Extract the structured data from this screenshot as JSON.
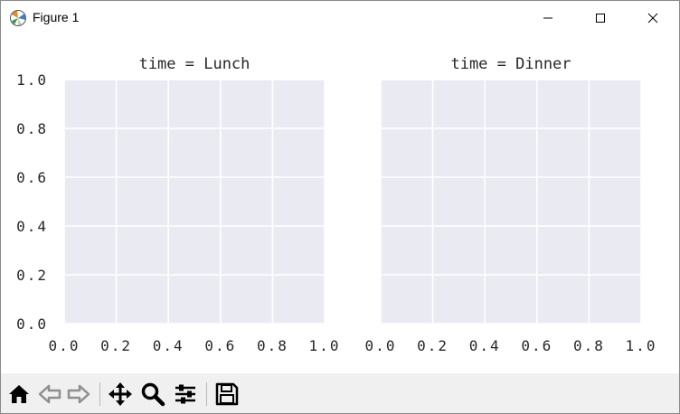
{
  "window": {
    "title": "Figure 1",
    "icons": [
      "matplotlib-icon",
      "minimize-icon",
      "maximize-icon",
      "close-icon"
    ]
  },
  "toolbar": {
    "buttons": [
      "home-icon",
      "back-icon",
      "forward-icon",
      "pan-icon",
      "zoom-icon",
      "configure-subplots-icon",
      "save-icon"
    ]
  },
  "colors": {
    "axes_face": "#eaeaf2",
    "grid": "#ffffff",
    "toolbar_bg": "#f0f0f0",
    "icon": "#000000",
    "icon_disabled": "#8f8f8f"
  },
  "chart_data": [
    {
      "type": "scatter",
      "title": "time = Lunch",
      "xlim": [
        0.0,
        1.0
      ],
      "ylim": [
        0.0,
        1.0
      ],
      "xticks": [
        "0.0",
        "0.2",
        "0.4",
        "0.6",
        "0.8",
        "1.0"
      ],
      "yticks": [
        "0.0",
        "0.2",
        "0.4",
        "0.6",
        "0.8",
        "1.0"
      ],
      "grid": true,
      "series": []
    },
    {
      "type": "scatter",
      "title": "time = Dinner",
      "xlim": [
        0.0,
        1.0
      ],
      "ylim": [
        0.0,
        1.0
      ],
      "xticks": [
        "0.0",
        "0.2",
        "0.4",
        "0.6",
        "0.8",
        "1.0"
      ],
      "yticks": [],
      "grid": true,
      "series": []
    }
  ]
}
